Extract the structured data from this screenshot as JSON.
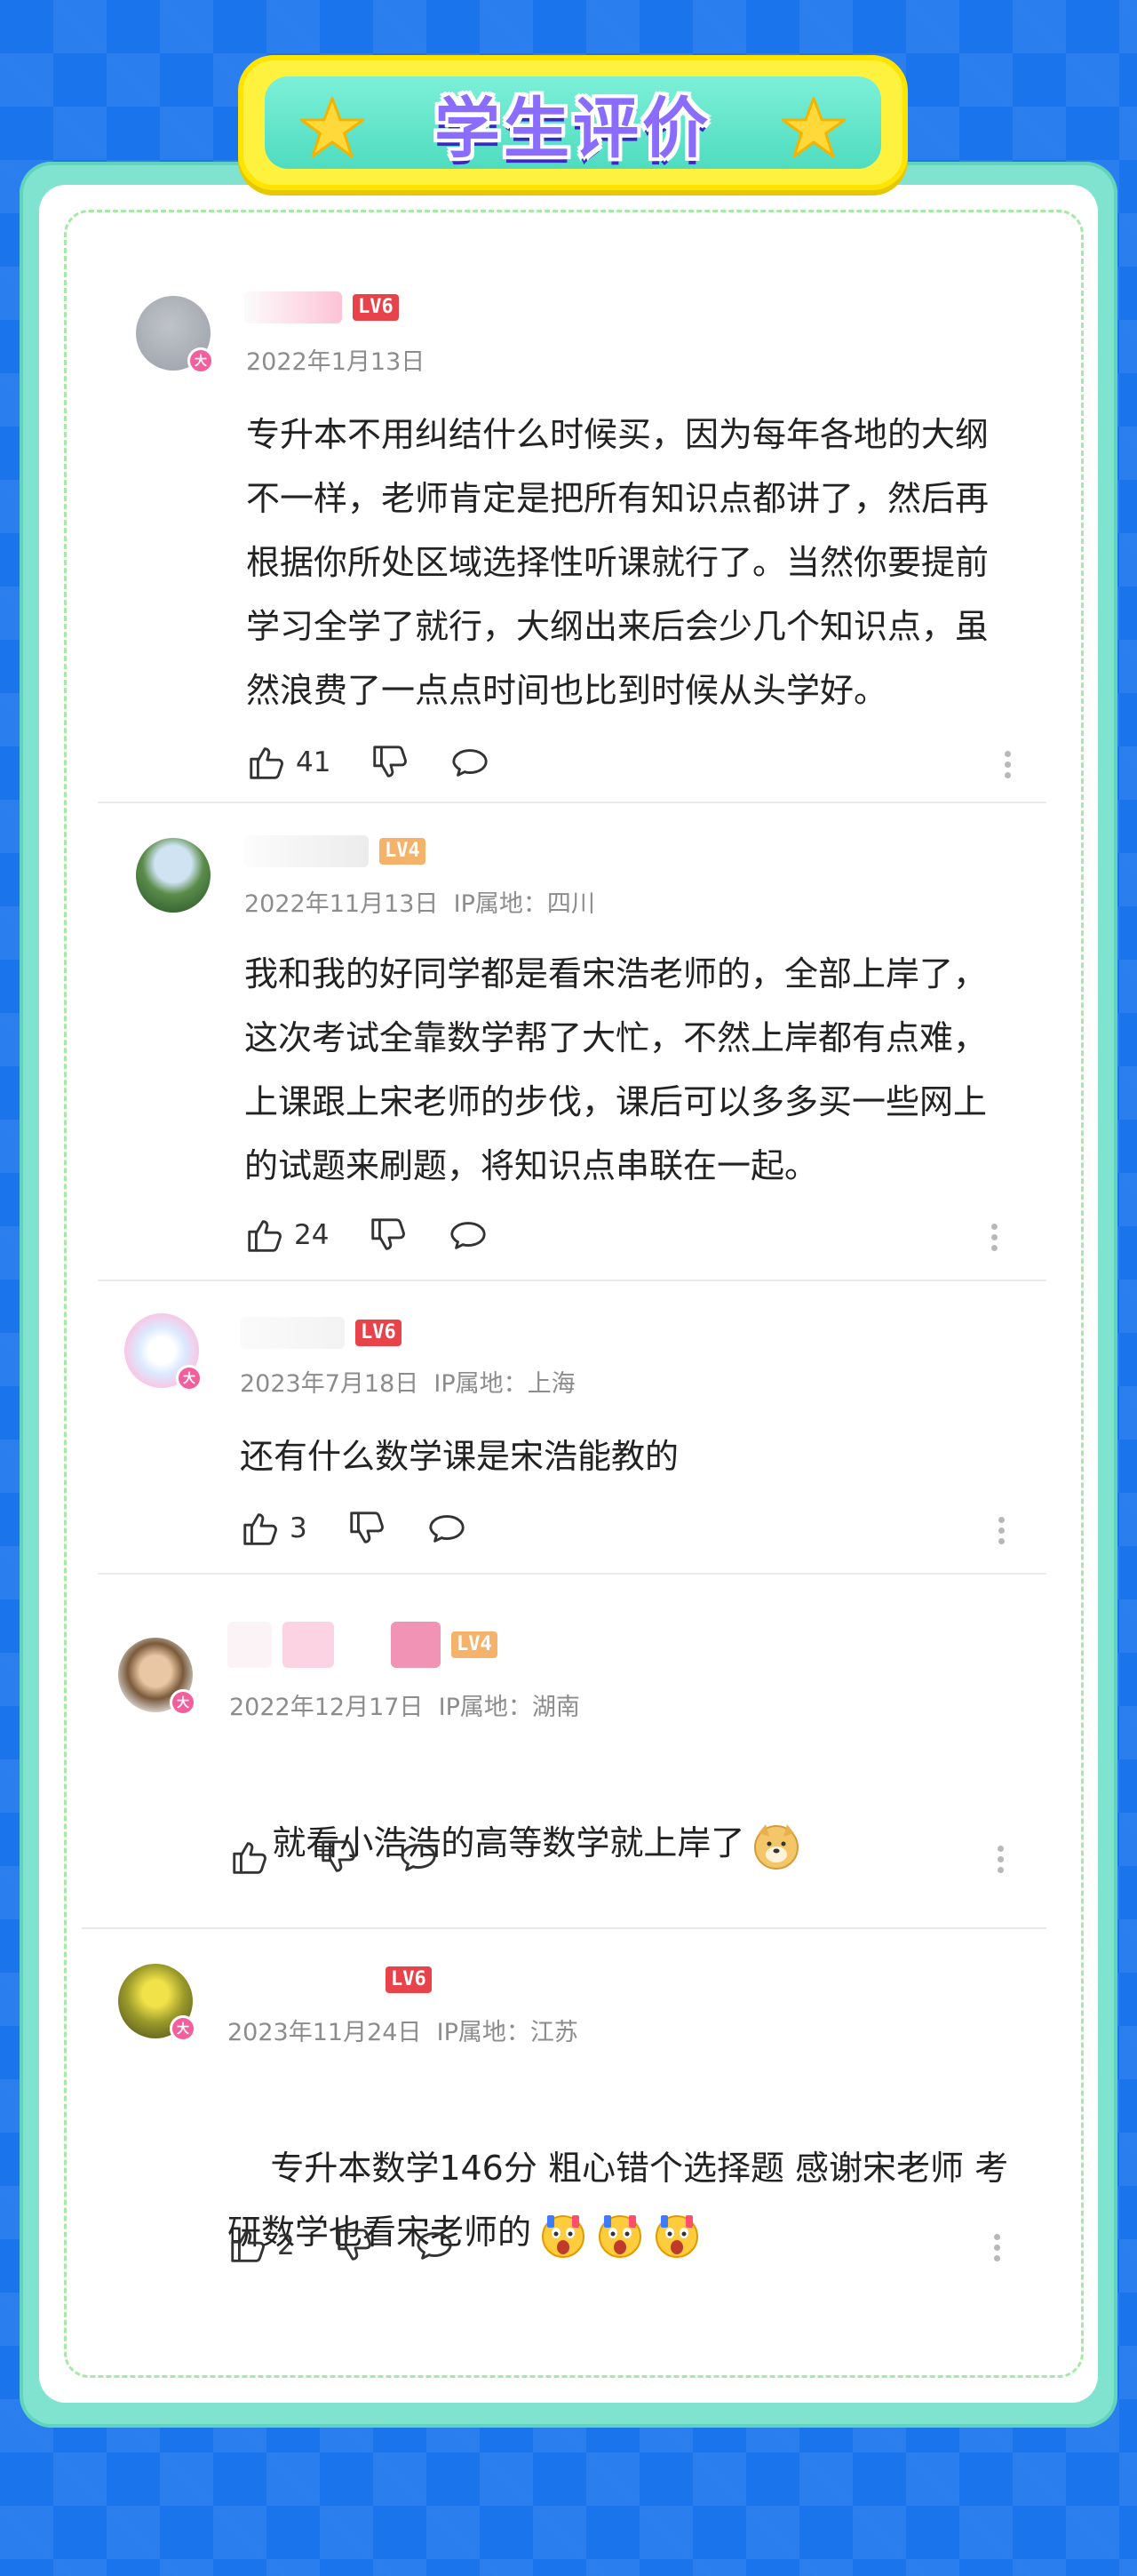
{
  "header": {
    "title": "学生评价"
  },
  "comments": [
    {
      "level": "LV6",
      "date": "2022年1月13日",
      "location": "",
      "text": "专升本不用纠结什么时候买，因为每年各地的大纲\n不一样，老师肯定是把所有知识点都讲了，然后再\n根据你所处区域选择性听课就行了。当然你要提前\n学习全学了就行，大纲出来后会少几个知识点，虽\n然浪费了一点点时间也比到时候从头学好。",
      "likes": "41",
      "avatar_badge": "大"
    },
    {
      "level": "LV4",
      "date": "2022年11月13日",
      "location": "IP属地：四川",
      "text": "我和我的好同学都是看宋浩老师的，全部上岸了，\n这次考试全靠数学帮了大忙，不然上岸都有点难，\n上课跟上宋老师的步伐，课后可以多多买一些网上\n的试题来刷题，将知识点串联在一起。",
      "likes": "24",
      "avatar_badge": ""
    },
    {
      "level": "LV6",
      "date": "2023年7月18日",
      "location": "IP属地：上海",
      "text": "还有什么数学课是宋浩能教的",
      "likes": "3",
      "avatar_badge": "大"
    },
    {
      "level": "LV4",
      "date": "2022年12月17日",
      "location": "IP属地：湖南",
      "text": "就看小浩浩的高等数学就上岸了",
      "likes": "",
      "avatar_badge": "大"
    },
    {
      "level": "LV6",
      "date": "2023年11月24日",
      "location": "IP属地：江苏",
      "text": "专升本数学146分 粗心错个选择题 感谢宋老师 考\n研数学也看宋老师的",
      "likes": "2",
      "avatar_badge": "大"
    }
  ],
  "icons": {
    "like": "thumbs-up-icon",
    "dislike": "thumbs-down-icon",
    "reply": "comment-bubble-icon",
    "more": "more-vertical-icon"
  },
  "colors": {
    "background": "#1a74ec",
    "frame": "#7fe3cf",
    "banner": "#fff23f",
    "title": "#8a6cff",
    "lv6": "#e8434a",
    "lv4": "#f4b26a",
    "badge": "#f25f9d"
  }
}
